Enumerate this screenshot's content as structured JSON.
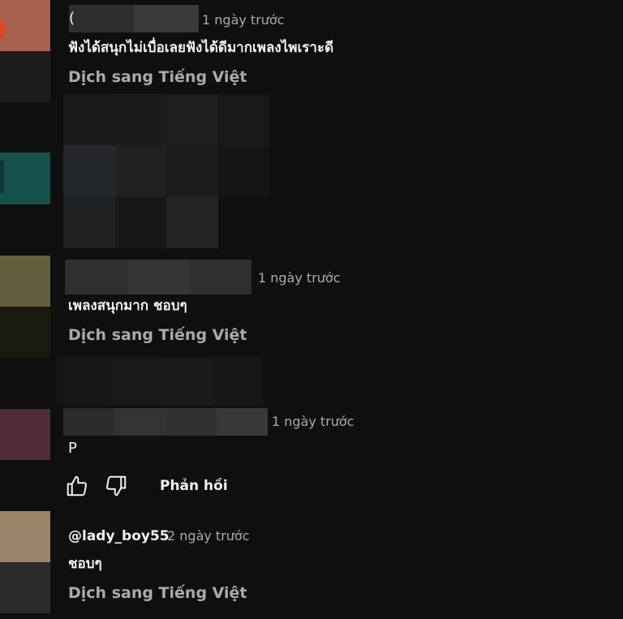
{
  "comments": [
    {
      "time": "1 ngày trước",
      "text": "ฟังได้สนุกไม่เบื่อเลยฟังได้ดีมากเพลงไพเราะดี",
      "translate": "Dịch sang Tiếng Việt"
    },
    {
      "time": "1 ngày trước",
      "text": "เพลงสนุกมาก ชอบๆ",
      "translate": "Dịch sang Tiếng Việt"
    },
    {
      "time": "1 ngày trước",
      "text": "P",
      "actions": {
        "reply_label": "Phản hồi"
      }
    },
    {
      "username": "@lady_boy55",
      "time": "2 ngày trước",
      "text": "ชอบๆ",
      "translate": "Dịch sang Tiếng Việt"
    }
  ],
  "icons": {
    "like": "thumbs-up-icon",
    "dislike": "thumbs-down-icon"
  },
  "colors": {
    "background": "#0f0f0f",
    "text_primary": "#f1f1f1",
    "text_secondary": "#aaaaaa"
  }
}
